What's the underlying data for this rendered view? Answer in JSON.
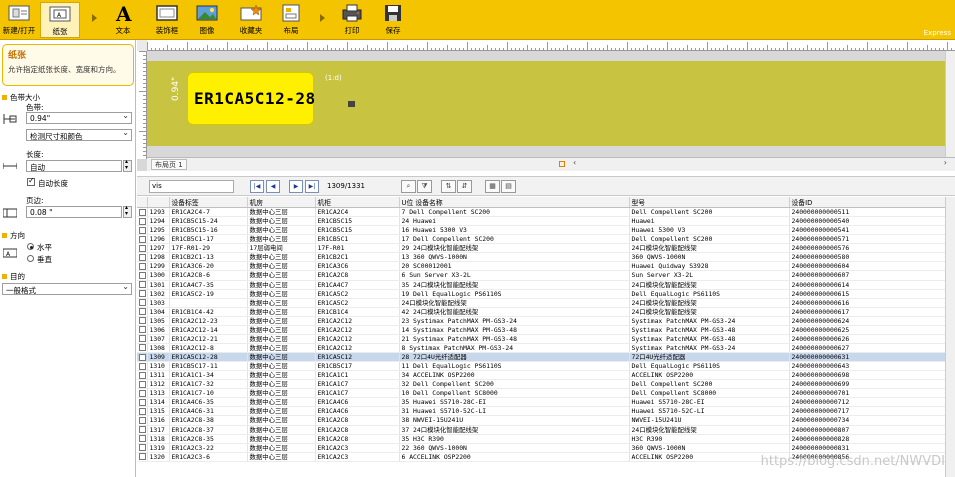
{
  "ribbon": {
    "buttons": [
      {
        "label": "新建/打开",
        "icon": "new-open-icon"
      },
      {
        "label": "纸张",
        "icon": "paper-icon"
      },
      {
        "label": "文本",
        "icon": "text-a-icon"
      },
      {
        "label": "装饰框",
        "icon": "frame-icon"
      },
      {
        "label": "图像",
        "icon": "image-icon"
      },
      {
        "label": "收藏夹",
        "icon": "favorites-icon"
      },
      {
        "label": "布局",
        "icon": "layout-icon"
      },
      {
        "label": "打印",
        "icon": "print-icon"
      },
      {
        "label": "保存",
        "icon": "save-icon"
      }
    ],
    "edition": "Express"
  },
  "tip": {
    "title": "纸张",
    "body": "允许指定纸张长度、宽度和方向。"
  },
  "left_panel": {
    "tape_section": "色带大小",
    "color_label": "色带:",
    "color_value": "0.94\"",
    "detect_value": "检测尺寸和颜色",
    "length_label": "长度:",
    "length_value": "自动",
    "auto_length_label": "自动长度",
    "auto_length_checked": true,
    "margin_label": "页边:",
    "margin_value": "0.08 \"",
    "orientation_section": "方向",
    "horizontal_label": "水平",
    "vertical_label": "垂直",
    "horizontal_selected": true,
    "purpose_section": "目的",
    "purpose_value": "一般格式"
  },
  "editor": {
    "label_text": "ER1CA5C12-28",
    "tape_dim": "0.94\"",
    "object_id": "(1:d)",
    "sheet_tab": "布局页 1"
  },
  "db_toolbar": {
    "search_value": "vis",
    "record_indicator": "1309/1331"
  },
  "grid": {
    "headers": [
      "设备标签",
      "机房",
      "机柜",
      "U位 设备名称",
      "型号",
      "设备ID"
    ],
    "selected_row": "1309",
    "rows": [
      [
        "1293",
        "ER1CA2C4-7",
        "数据中心三层",
        "ER1CA2C4",
        "7 Dell Compellent SC200",
        "Dell Compellent SC200",
        "240000000000511"
      ],
      [
        "1294",
        "ER1CB5C15-24",
        "数据中心三层",
        "ER1CB5C15",
        "24 Huawei",
        "Huawei",
        "240000000000540"
      ],
      [
        "1295",
        "ER1CB5C15-16",
        "数据中心三层",
        "ER1CB5C15",
        "16 Huawei 5300 V3",
        "Huawei 5300 V3",
        "240000000000541"
      ],
      [
        "1296",
        "ER1CB5C1-17",
        "数据中心三层",
        "ER1CB5C1",
        "17 Dell Compellent SC200",
        "Dell Compellent SC200",
        "240000000000571"
      ],
      [
        "1297",
        "17F-R01-29",
        "17层弱电间",
        "17F-R01",
        "29 24口模块化智能配线架",
        "24口模块化智能配线架",
        "240000000000576"
      ],
      [
        "1298",
        "ER1CB2C1-13",
        "数据中心三层",
        "ER1CB2C1",
        "13 360 QWVS-1000N",
        "360 QWVS-1000N",
        "240000000000580"
      ],
      [
        "1299",
        "ER1CA3C6-20",
        "数据中心三层",
        "ER1CA3C6",
        "20 SC00012001",
        "Huawei Quidway S3928",
        "240000000000604"
      ],
      [
        "1300",
        "ER1CA2C8-6",
        "数据中心三层",
        "ER1CA2C8",
        "6 Sun Server X3-2L",
        "Sun Server X3-2L",
        "240000000000607"
      ],
      [
        "1301",
        "ER1CA4C7-35",
        "数据中心三层",
        "ER1CA4C7",
        "35 24口模块化智能配线架",
        "24口模块化智能配线架",
        "240000000000614"
      ],
      [
        "1302",
        "ER1CA5C2-19",
        "数据中心三层",
        "ER1CA5C2",
        "19 Dell EqualLogic PS6110S",
        "Dell EqualLogic PS6110S",
        "240000000000615"
      ],
      [
        "1303",
        "",
        "数据中心三层",
        "ER1CA5C2",
        "24口模块化智能配线架",
        "24口模块化智能配线架",
        "240000000000616"
      ],
      [
        "1304",
        "ER1CB1C4-42",
        "数据中心三层",
        "ER1CB1C4",
        "42 24口模块化智能配线架",
        "24口模块化智能配线架",
        "240000000000617"
      ],
      [
        "1305",
        "ER1CA2C12-23",
        "数据中心三层",
        "ER1CA2C12",
        "23 Systimax PatchMAX PM-GS3-24",
        "Systimax PatchMAX PM-GS3-24",
        "240000000000624"
      ],
      [
        "1306",
        "ER1CA2C12-14",
        "数据中心三层",
        "ER1CA2C12",
        "14 Systimax PatchMAX PM-GS3-48",
        "Systimax PatchMAX PM-GS3-48",
        "240000000000625"
      ],
      [
        "1307",
        "ER1CA2C12-21",
        "数据中心三层",
        "ER1CA2C12",
        "21 Systimax PatchMAX PM-GS3-48",
        "Systimax PatchMAX PM-GS3-48",
        "240000000000626"
      ],
      [
        "1308",
        "ER1CA2C12-8",
        "数据中心三层",
        "ER1CA2C12",
        "8 Systimax PatchMAX PM-GS3-24",
        "Systimax PatchMAX PM-GS3-24",
        "240000000000627"
      ],
      [
        "1309",
        "ER1CA5C12-28",
        "数据中心三层",
        "ER1CA5C12",
        "28 72口4U光纤适配器",
        "72口4U光纤适配器",
        "240000000000631"
      ],
      [
        "1310",
        "ER1CB5C17-11",
        "数据中心三层",
        "ER1CB5C17",
        "11 Dell EqualLogic PS6110S",
        "Dell EqualLogic PS6110S",
        "240000000000643"
      ],
      [
        "1311",
        "ER1CA1C1-34",
        "数据中心三层",
        "ER1CA1C1",
        "34 ACCELINK OSP2200",
        "ACCELINK OSP2200",
        "240000000000698"
      ],
      [
        "1312",
        "ER1CA1C7-32",
        "数据中心三层",
        "ER1CA1C7",
        "32 Dell Compellent SC200",
        "Dell Compellent SC200",
        "240000000000699"
      ],
      [
        "1313",
        "ER1CA1C7-10",
        "数据中心三层",
        "ER1CA1C7",
        "10 Dell Compellent SC8000",
        "Dell Compellent SC8000",
        "240000000000701"
      ],
      [
        "1314",
        "ER1CA4C6-35",
        "数据中心三层",
        "ER1CA4C6",
        "35 Huawei S5710-28C-EI",
        "Huawei S5710-28C-EI",
        "240000000000712"
      ],
      [
        "1315",
        "ER1CA4C6-31",
        "数据中心三层",
        "ER1CA4C6",
        "31 Huawei S5710-52C-LI",
        "Huawei S5710-52C-LI",
        "240000000000717"
      ],
      [
        "1316",
        "ER1CA2C8-38",
        "数据中心三层",
        "ER1CA2C8",
        "38 NWVEI-15U241U",
        "NWVEI-15U241U",
        "240000000000734"
      ],
      [
        "1317",
        "ER1CA2C8-37",
        "数据中心三层",
        "ER1CA2C8",
        "37 24口模块化智能配线架",
        "24口模块化智能配线架",
        "240000000000807"
      ],
      [
        "1318",
        "ER1CA2C8-35",
        "数据中心三层",
        "ER1CA2C8",
        "35 H3C R390",
        "H3C R390",
        "240000000000828"
      ],
      [
        "1319",
        "ER1CA2C3-22",
        "数据中心三层",
        "ER1CA2C3",
        "22 360 QWVS-1000N",
        "360 QWVS-1000N",
        "240000000000831"
      ],
      [
        "1320",
        "ER1CA2C3-6",
        "数据中心三层",
        "ER1CA2C3",
        "6 ACCELINK OSP2200",
        "ACCELINK OSP2200",
        "240000000000856"
      ]
    ]
  },
  "watermark": "https://blog.csdn.net/NWVDI"
}
